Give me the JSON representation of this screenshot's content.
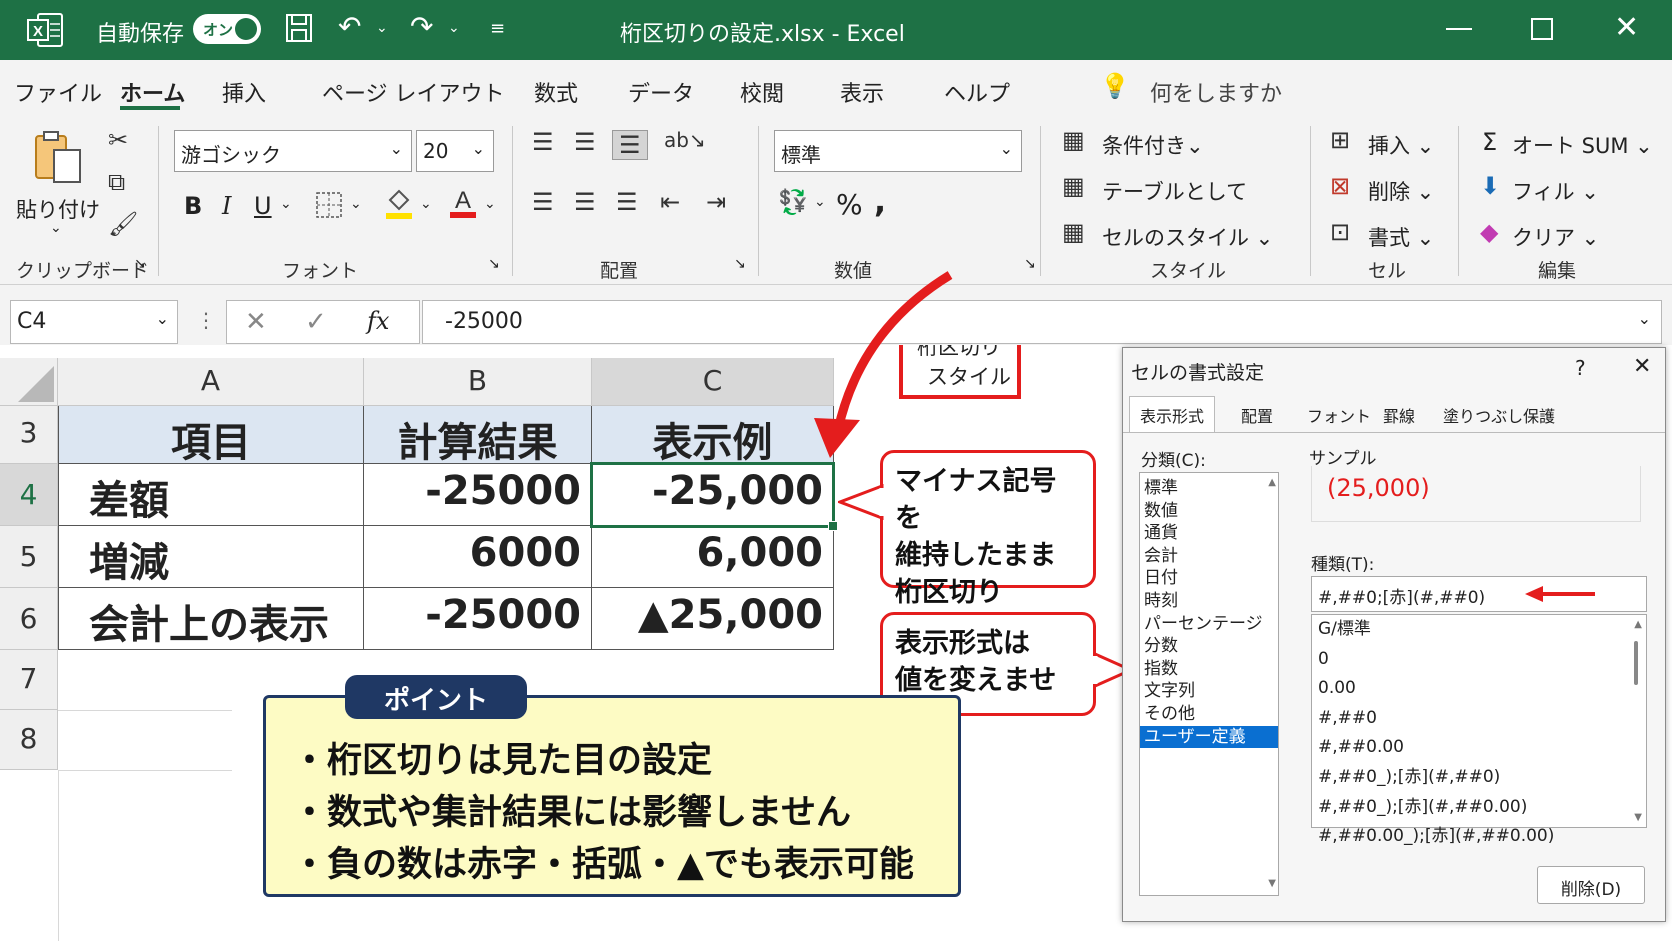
{
  "titlebar": {
    "autosave_label": "自動保存",
    "autosave_state": "オン",
    "file_title": "桁区切りの設定.xlsx - Excel"
  },
  "tabs": [
    "ファイル",
    "ホーム",
    "挿入",
    "ページ レイアウト",
    "数式",
    "データ",
    "校閲",
    "表示",
    "ヘルプ"
  ],
  "tell_me": "何をしますか",
  "ribbon": {
    "paste_label": "貼り付け",
    "font_name": "游ゴシック",
    "font_size": "20",
    "number_format": "標準",
    "comma_style_label_1": "桁区切り",
    "comma_style_label_2": "スタイル",
    "cond_format": "条件付き",
    "as_table": "テーブルとして",
    "cell_style": "セルのスタイル",
    "insert": "挿入",
    "delete": "削除",
    "format": "書式",
    "autosum": "オート SUM",
    "fill": "フィル",
    "clear": "クリア",
    "groups": {
      "clipboard": "クリップボード",
      "font": "フォント",
      "alignment": "配置",
      "number": "数値",
      "styles": "スタイル",
      "cells": "セル",
      "editing": "編集"
    }
  },
  "formula_bar": {
    "name_box": "C4",
    "formula": "-25000"
  },
  "sheet": {
    "col_headers": [
      "A",
      "B",
      "C"
    ],
    "row_headers": [
      "3",
      "4",
      "5",
      "6",
      "7",
      "8"
    ],
    "header_row": [
      "項目",
      "計算結果",
      "表示例"
    ],
    "rows": [
      [
        "差額",
        "-25000",
        "-25,000"
      ],
      [
        "増減",
        "6000",
        "6,000"
      ],
      [
        "会計上の表示",
        "-25000",
        "▲25,000"
      ]
    ]
  },
  "callouts": {
    "c1": [
      "マイナス記号を",
      "維持したまま",
      "桁区切り"
    ],
    "c2": [
      "表示形式は",
      "値を変えません"
    ]
  },
  "point": {
    "tag": "ポイント",
    "lines": [
      "・桁区切りは見た目の設定",
      "・数式や集計結果には影響しません",
      "・負の数は赤字・括弧・▲でも表示可能"
    ]
  },
  "dialog": {
    "title": "セルの書式設定",
    "tabs": [
      "表示形式",
      "配置",
      "フォント",
      "罫線",
      "塗りつぶし",
      "保護"
    ],
    "category_label": "分類(C):",
    "categories": [
      "標準",
      "数値",
      "通貨",
      "会計",
      "日付",
      "時刻",
      "パーセンテージ",
      "分数",
      "指数",
      "文字列",
      "その他",
      "ユーザー定義"
    ],
    "selected_category": 11,
    "sample_label": "サンプル",
    "sample_value": "(25,000)",
    "type_label": "種類(T):",
    "type_value": "#,##0;[赤](#,##0)",
    "formats": [
      "G/標準",
      "0",
      "0.00",
      "#,##0",
      "#,##0.00",
      "#,##0_);[赤](#,##0)",
      "#,##0_);[赤](#,##0.00)",
      "#,##0.00_);[赤](#,##0.00)"
    ],
    "delete_button": "削除(D)"
  },
  "colors": {
    "excel_green": "#1e7145",
    "callout_red": "#e41d1d",
    "point_navy": "#1f3864",
    "point_bg": "#fdfbc4"
  }
}
